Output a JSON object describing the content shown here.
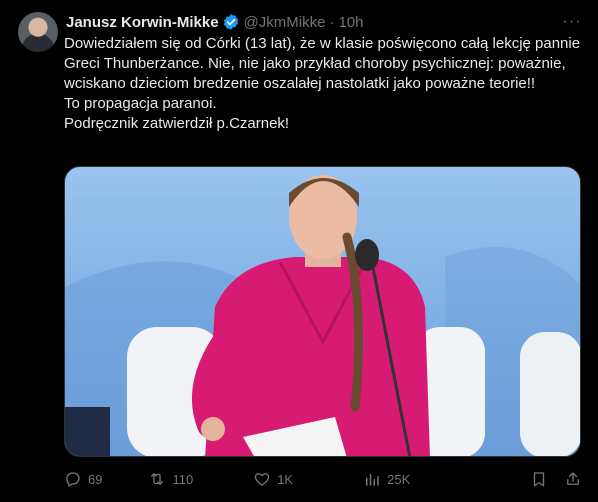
{
  "author": {
    "name": "Janusz Korwin-Mikke",
    "handle": "@JkmMikke",
    "separator": "·",
    "time": "10h"
  },
  "tweet": {
    "text": "Dowiedziałem się od Córki (13 lat), że w klasie poświęcono całą lekcję pannie Greci Thunberżance. Nie, nie jako przykład choroby psychicznej: poważnie, wciskano dzieciom bredzenie oszalałej nastolatki jako poważne teorie!!\nTo propagacja paranoi.\nPodręcznik zatwierdził p.Czarnek!"
  },
  "actions": {
    "replies": "69",
    "reposts": "110",
    "likes": "1K",
    "views": "25K"
  },
  "colors": {
    "background": "#000000",
    "text": "#e7e9ea",
    "muted": "#71767b",
    "verified": "#1d9bf0",
    "accent_pink": "#d81b72"
  }
}
